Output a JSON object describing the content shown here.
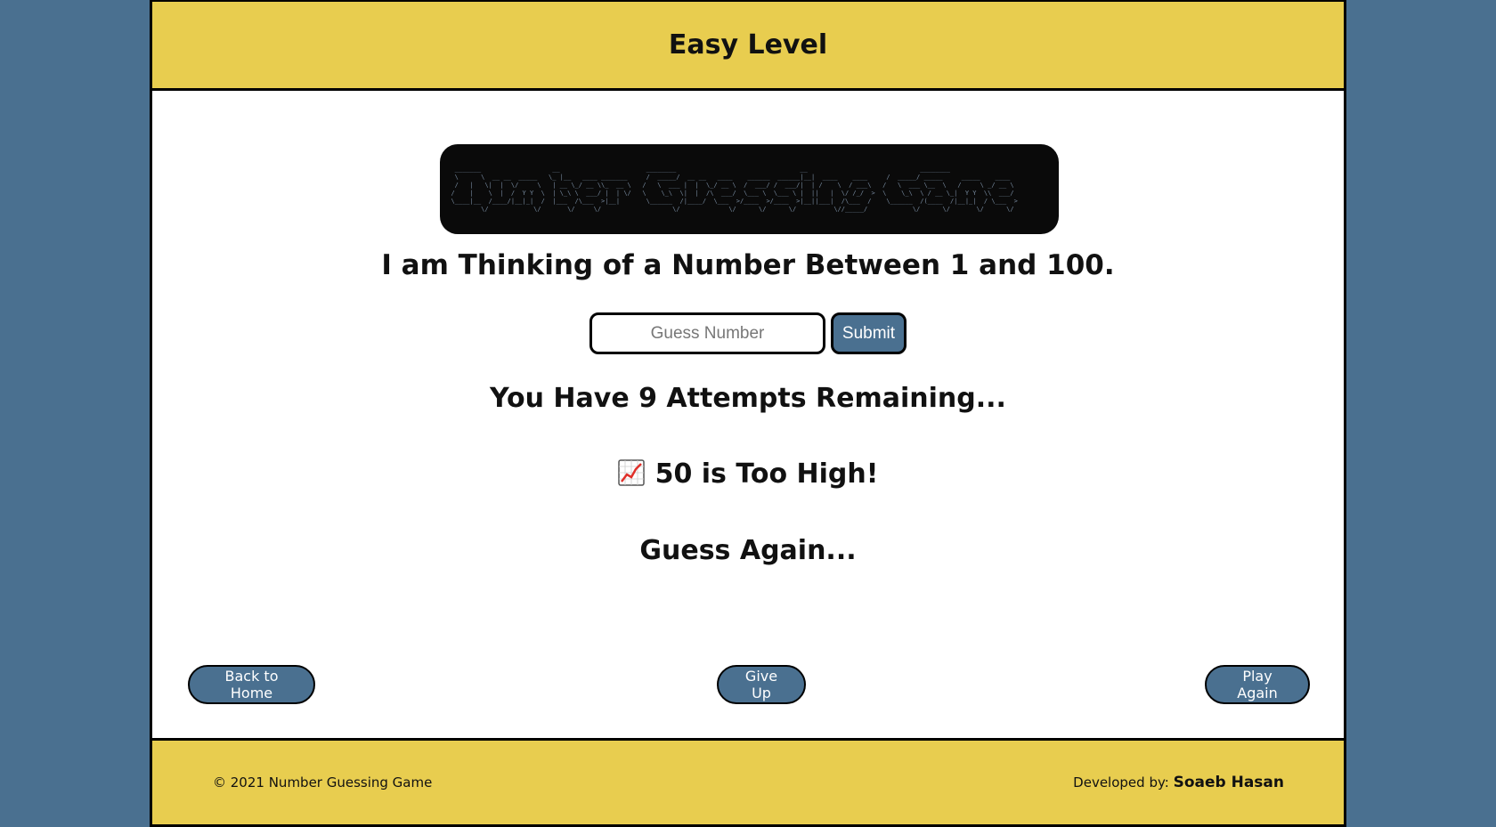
{
  "header": {
    "title": "Easy Level"
  },
  "main": {
    "prompt": "I am Thinking of a Number Between 1 and 100.",
    "guess_placeholder": "Guess Number",
    "submit_label": "Submit",
    "attempts_text": "You Have 9 Attempts Remaining...",
    "feedback_text": "50 is Too High!",
    "guess_again_text": "Guess Again..."
  },
  "buttons": {
    "home_label": "Back to Home",
    "giveup_label": "Give Up",
    "play_again_label": "Play Again"
  },
  "footer": {
    "copyright": "© 2021 Number Guessing Game",
    "dev_prefix": "Developed by:",
    "dev_name": "Soaeb Hasan"
  },
  "colors": {
    "background": "#4a7090",
    "accent_yellow": "#e8cd4f",
    "button_blue": "#4a7090"
  },
  "icons": {
    "feedback_icon": "chart-increasing-icon"
  }
}
